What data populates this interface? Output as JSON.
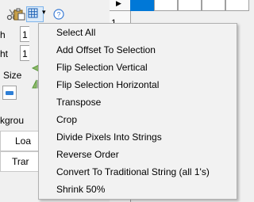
{
  "toolbar": {
    "icons": [
      "scissors-icon",
      "paste-icon",
      "grid-select-icon",
      "help-icon"
    ],
    "dropdown_arrow": "▾"
  },
  "left_panel": {
    "width_label": "h",
    "height_label": "ht",
    "width_value": "1",
    "height_value": "1",
    "size_label": "Size",
    "background_label": "kgrou",
    "load_label": "Loa",
    "transfer_label": "Trar"
  },
  "grid": {
    "row_marker": "▶",
    "row_number": "1",
    "selected_color": "#0078d7"
  },
  "menu": {
    "items": [
      {
        "label": "Select All",
        "icon": ""
      },
      {
        "label": "Add Offset To Selection",
        "icon": ""
      },
      {
        "label": "Flip Selection Vertical",
        "icon": "flip-vertical-icon"
      },
      {
        "label": "Flip Selection Horizontal",
        "icon": "flip-horizontal-icon"
      },
      {
        "label": "Transpose",
        "icon": ""
      },
      {
        "label": "Crop",
        "icon": ""
      },
      {
        "label": "Divide Pixels Into Strings",
        "icon": ""
      },
      {
        "label": "Reverse Order",
        "icon": ""
      },
      {
        "label": "Convert To Traditional String (all 1's)",
        "icon": ""
      },
      {
        "label": "Shrink 50%",
        "icon": ""
      }
    ]
  },
  "colors": {
    "accent": "#0078d7",
    "arrow_green": "#5a9a3c",
    "menu_bg": "#f2f2f2"
  }
}
